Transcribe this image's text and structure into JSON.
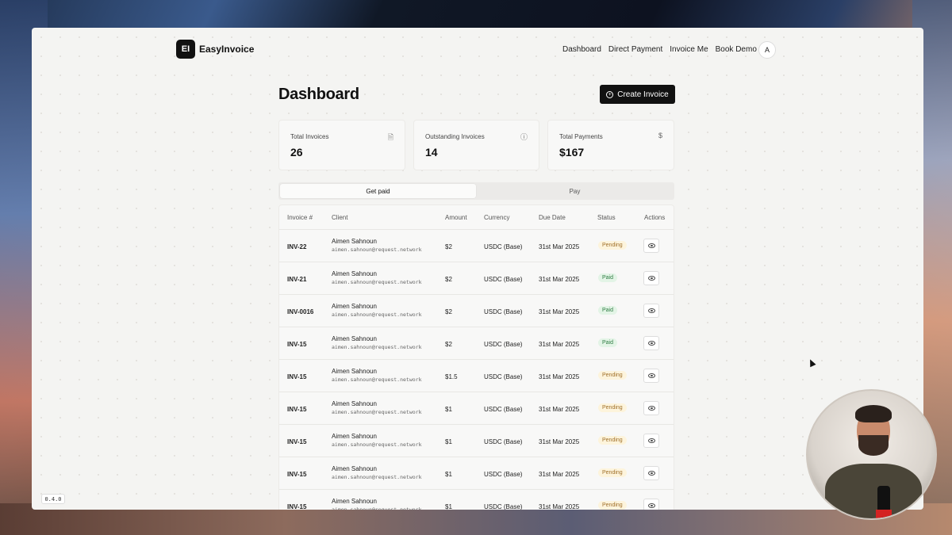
{
  "app": {
    "logo_initials": "EI",
    "name": "EasyInvoice",
    "version": "0.4.0"
  },
  "nav": {
    "links": [
      "Dashboard",
      "Direct Payment",
      "Invoice Me",
      "Book Demo"
    ],
    "avatar_initial": "A"
  },
  "page": {
    "title": "Dashboard",
    "create_button_label": "Create Invoice"
  },
  "stats": [
    {
      "label": "Total Invoices",
      "value": "26",
      "icon": "file-icon"
    },
    {
      "label": "Outstanding Invoices",
      "value": "14",
      "icon": "info-circle-icon"
    },
    {
      "label": "Total Payments",
      "value": "$167",
      "icon": "dollar-icon"
    }
  ],
  "tabs": [
    "Get paid",
    "Pay"
  ],
  "table": {
    "headers": [
      "Invoice #",
      "Client",
      "Amount",
      "Currency",
      "Due Date",
      "Status",
      "Actions"
    ],
    "rows": [
      {
        "invoice": "INV-22",
        "client_name": "Aimen Sahnoun",
        "client_email": "aimen.sahnoun@request.network",
        "amount": "$2",
        "currency": "USDC (Base)",
        "due": "31st Mar 2025",
        "status": "Pending"
      },
      {
        "invoice": "INV-21",
        "client_name": "Aimen Sahnoun",
        "client_email": "aimen.sahnoun@request.network",
        "amount": "$2",
        "currency": "USDC (Base)",
        "due": "31st Mar 2025",
        "status": "Paid"
      },
      {
        "invoice": "INV-0016",
        "client_name": "Aimen Sahnoun",
        "client_email": "aimen.sahnoun@request.network",
        "amount": "$2",
        "currency": "USDC (Base)",
        "due": "31st Mar 2025",
        "status": "Paid"
      },
      {
        "invoice": "INV-15",
        "client_name": "Aimen Sahnoun",
        "client_email": "aimen.sahnoun@request.network",
        "amount": "$2",
        "currency": "USDC (Base)",
        "due": "31st Mar 2025",
        "status": "Paid"
      },
      {
        "invoice": "INV-15",
        "client_name": "Aimen Sahnoun",
        "client_email": "aimen.sahnoun@request.network",
        "amount": "$1.5",
        "currency": "USDC (Base)",
        "due": "31st Mar 2025",
        "status": "Pending"
      },
      {
        "invoice": "INV-15",
        "client_name": "Aimen Sahnoun",
        "client_email": "aimen.sahnoun@request.network",
        "amount": "$1",
        "currency": "USDC (Base)",
        "due": "31st Mar 2025",
        "status": "Pending"
      },
      {
        "invoice": "INV-15",
        "client_name": "Aimen Sahnoun",
        "client_email": "aimen.sahnoun@request.network",
        "amount": "$1",
        "currency": "USDC (Base)",
        "due": "31st Mar 2025",
        "status": "Pending"
      },
      {
        "invoice": "INV-15",
        "client_name": "Aimen Sahnoun",
        "client_email": "aimen.sahnoun@request.network",
        "amount": "$1",
        "currency": "USDC (Base)",
        "due": "31st Mar 2025",
        "status": "Pending"
      },
      {
        "invoice": "INV-15",
        "client_name": "Aimen Sahnoun",
        "client_email": "aimen.sahnoun@request.network",
        "amount": "$1",
        "currency": "USDC (Base)",
        "due": "31st Mar 2025",
        "status": "Pending"
      }
    ]
  }
}
